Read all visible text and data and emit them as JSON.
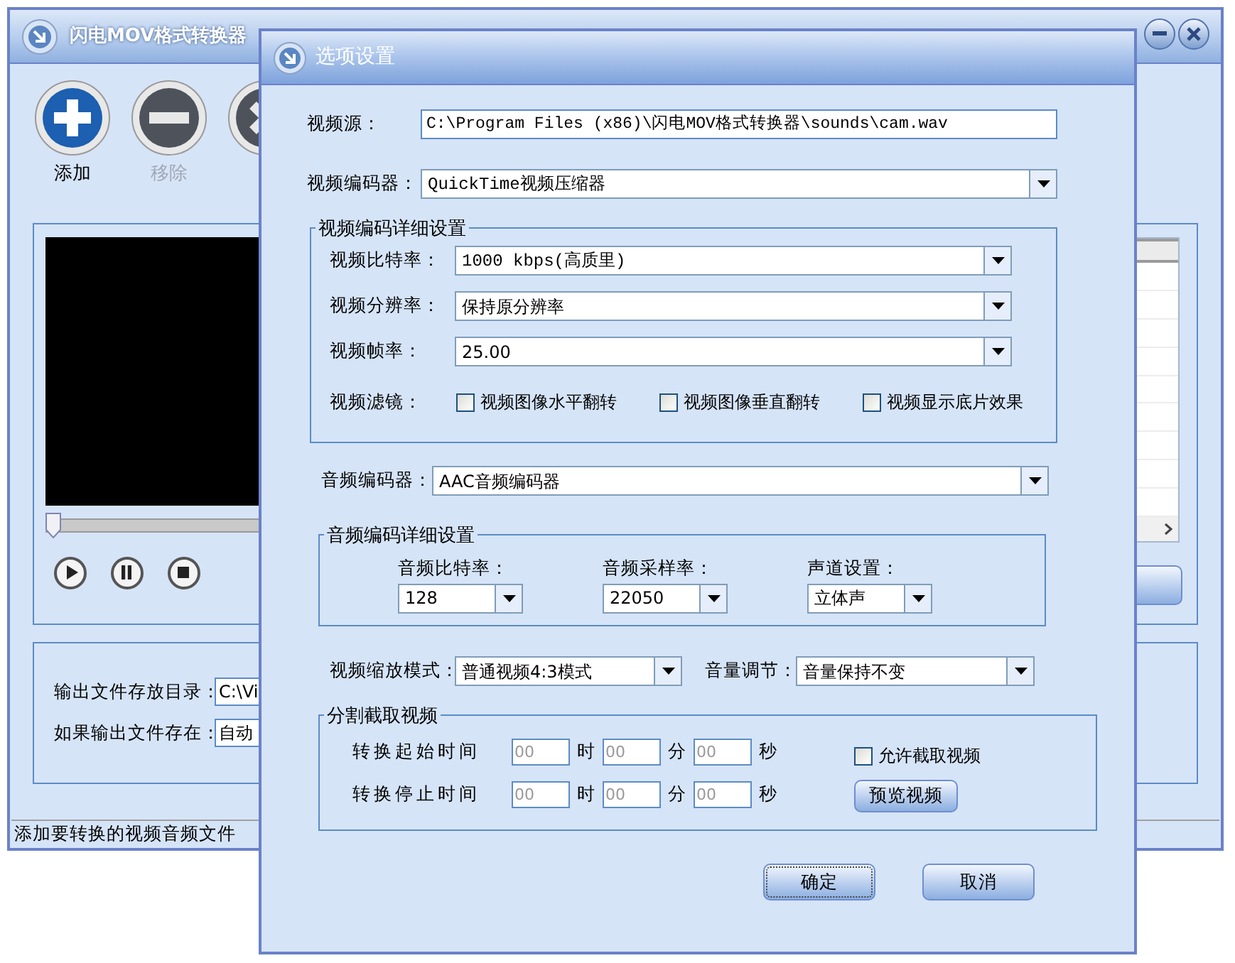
{
  "main_window": {
    "title": "闪电MOV格式转换器",
    "toolbar": [
      {
        "kind": "add",
        "label": "添加",
        "disabled": false
      },
      {
        "kind": "remove",
        "label": "移除",
        "disabled": true
      },
      {
        "kind": "clear"
      }
    ],
    "seek_slider": {
      "level": 0
    },
    "output": [
      {
        "label": "输出文件存放目录：",
        "value": "C:\\Vi"
      },
      {
        "label": "如果输出文件存在：",
        "value": "自动"
      }
    ],
    "status_bar": "添加要转换的视频音频文件"
  },
  "dialog": {
    "title": "选项设置",
    "source": {
      "label": "视频源：",
      "value": "C:\\Program Files (x86)\\闪电MOV格式转换器\\sounds\\cam.wav"
    },
    "video_codec": {
      "label": "视频编码器：",
      "value": "QuickTime视频压缩器"
    },
    "video_details": {
      "legend": "视频编码详细设置",
      "selects": [
        {
          "label": "视频比特率：",
          "value": "1000 kbps(高质里)"
        },
        {
          "label": "视频分辨率：",
          "value": "保持原分辨率"
        },
        {
          "label": "视频帧率：",
          "value": "25.00"
        }
      ],
      "filter_label": "视频滤镜：",
      "filters": [
        {
          "label": "视频图像水平翻转",
          "checked": false
        },
        {
          "label": "视频图像垂直翻转",
          "checked": false
        },
        {
          "label": "视频显示底片效果",
          "checked": false
        }
      ]
    },
    "audio_codec": {
      "label": "音频编码器：",
      "value": "AAC音频编码器"
    },
    "audio_details": {
      "legend": "音频编码详细设置",
      "items": [
        {
          "label": "音频比特率：",
          "value": "128"
        },
        {
          "label": "音频采样率：",
          "value": "22050"
        },
        {
          "label": "声道设置：",
          "value": "立体声"
        }
      ]
    },
    "zoom_mode": {
      "label": "视频缩放模式：",
      "value": "普通视频4:3模式"
    },
    "volume": {
      "label": "音量调节：",
      "value": "音量保持不变"
    },
    "clip": {
      "legend": "分割截取视频",
      "disabled": true,
      "rows": [
        {
          "label": "转换起始时间",
          "fields": [
            {
              "value": "00",
              "unit": "时"
            },
            {
              "value": "00",
              "unit": "分"
            },
            {
              "value": "00",
              "unit": "秒"
            }
          ]
        },
        {
          "label": "转换停止时间",
          "fields": [
            {
              "value": "00",
              "unit": "时"
            },
            {
              "value": "00",
              "unit": "分"
            },
            {
              "value": "00",
              "unit": "秒"
            }
          ]
        }
      ],
      "allow": {
        "label": "允许截取视频",
        "checked": false
      },
      "preview_button": "预览视频"
    },
    "buttons": [
      {
        "label": "确定",
        "focused": true
      },
      {
        "label": "取消",
        "focused": false
      }
    ]
  }
}
